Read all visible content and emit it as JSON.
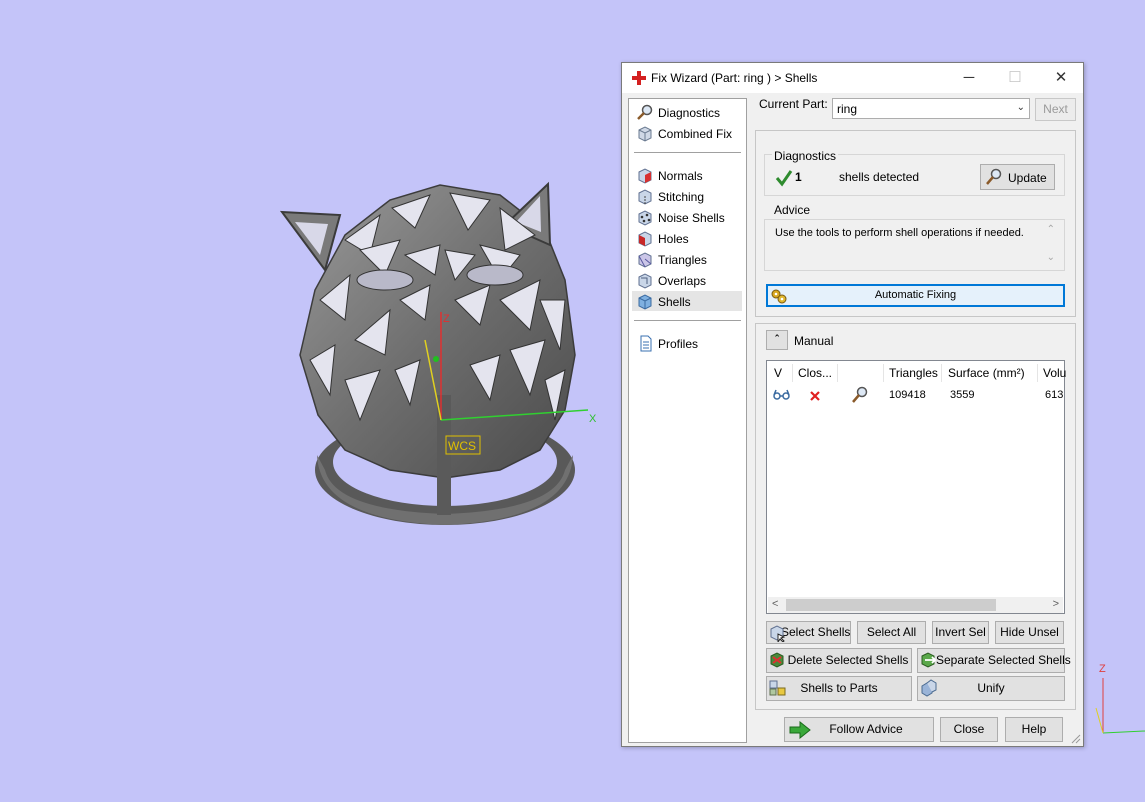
{
  "viewport": {
    "axis_labels": {
      "z": "Z",
      "x": "X"
    },
    "wcs_label": "WCS",
    "corner_axis_label": "Z"
  },
  "dialog": {
    "title": "Fix Wizard (Part: ring ) > Shells",
    "window_buttons": {
      "minimize": "─",
      "maximize": "☐",
      "close": "✕"
    }
  },
  "nav": {
    "top_items": [
      {
        "label": "Diagnostics",
        "icon": "magnifier-icon"
      },
      {
        "label": "Combined Fix",
        "icon": "cube-icon"
      }
    ],
    "fix_items": [
      {
        "label": "Normals",
        "icon": "normals-cube-icon"
      },
      {
        "label": "Stitching",
        "icon": "stitching-cube-icon"
      },
      {
        "label": "Noise Shells",
        "icon": "noise-shells-icon"
      },
      {
        "label": "Holes",
        "icon": "holes-cube-icon"
      },
      {
        "label": "Triangles",
        "icon": "triangles-cube-icon"
      },
      {
        "label": "Overlaps",
        "icon": "overlaps-cube-icon"
      },
      {
        "label": "Shells",
        "icon": "shells-cube-icon"
      }
    ],
    "selected": "Shells",
    "bottom_items": [
      {
        "label": "Profiles",
        "icon": "document-icon"
      }
    ]
  },
  "current_part": {
    "label": "Current Part:",
    "value": "ring",
    "next_label": "Next"
  },
  "diagnostics": {
    "title": "Diagnostics",
    "count": "1",
    "text": "shells detected",
    "update_label": "Update"
  },
  "advice": {
    "title": "Advice",
    "text": "Use the tools to perform shell operations if needed."
  },
  "automatic_fixing_label": "Automatic Fixing",
  "manual": {
    "title": "Manual",
    "collapse_icon": "double-chevron-up-icon",
    "columns": [
      "V",
      "Clos...",
      "",
      "Triangles",
      "Surface (mm²)",
      "Volu"
    ],
    "rows": [
      {
        "visible_icon": "glasses-icon",
        "closed_icon": "red-x-icon",
        "zoom_icon": "magnifier-icon",
        "triangles": "109418",
        "surface": "3559",
        "volume": "613"
      }
    ],
    "scroll_left": "<",
    "scroll_right": ">"
  },
  "buttons": {
    "select_shells": "Select Shells",
    "select_all": "Select All",
    "invert_sel": "Invert Sel",
    "hide_unsel": "Hide Unsel",
    "delete_selected": "Delete Selected Shells",
    "separate_selected": "Separate Selected Shells",
    "shells_to_parts": "Shells to Parts",
    "unify": "Unify",
    "follow_advice": "Follow Advice",
    "close": "Close",
    "help": "Help"
  },
  "colors": {
    "viewport_background": "#c4c4f9",
    "dialog_background": "#f0f0f0",
    "accent_blue": "#0078d7",
    "check_green": "#2e8b2e",
    "error_red": "#e02020"
  }
}
